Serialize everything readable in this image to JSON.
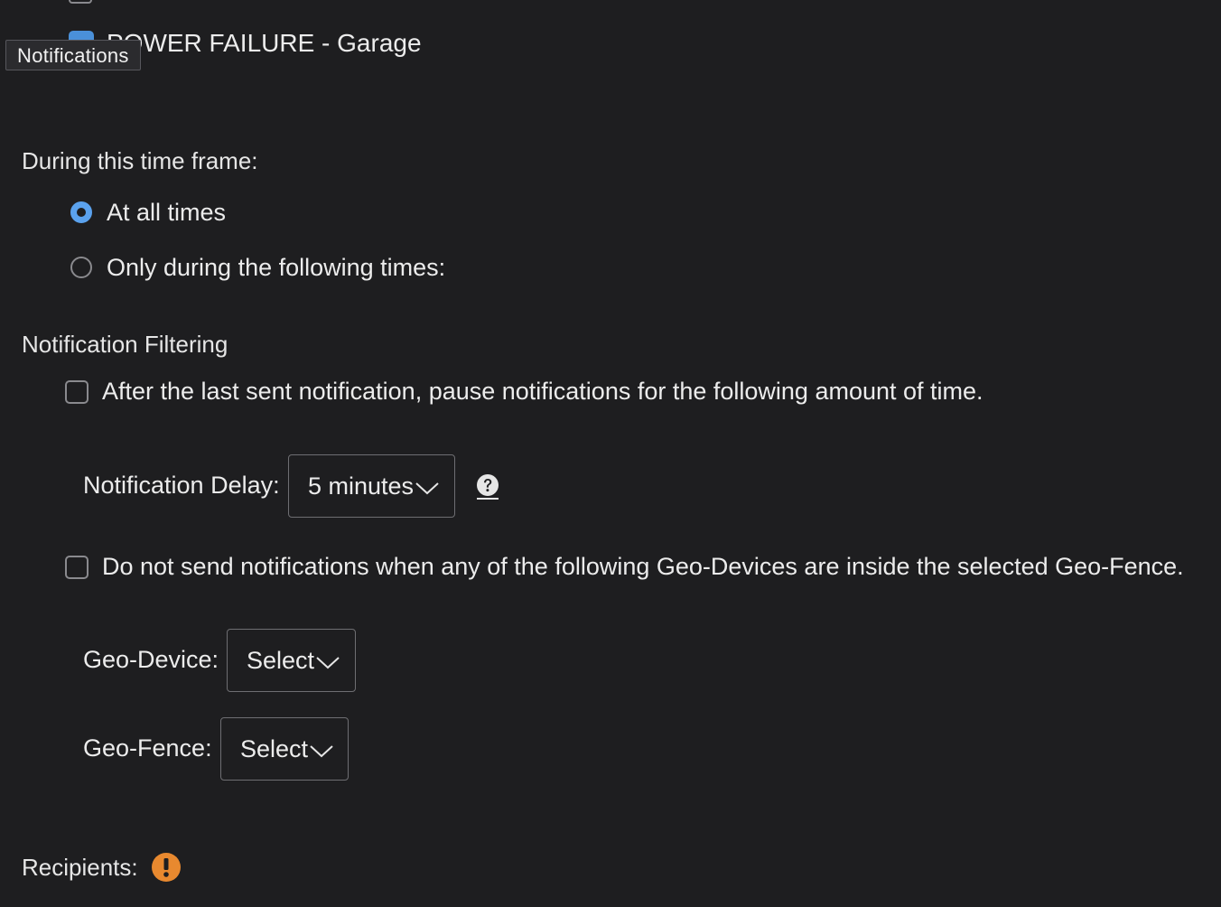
{
  "top": {
    "checked_item_label": "POWER FAILURE - Garage",
    "tooltip": "Notifications"
  },
  "time_frame": {
    "title": "During this time frame:",
    "options": [
      {
        "label": "At all times",
        "selected": true
      },
      {
        "label": "Only during the following times:",
        "selected": false
      }
    ]
  },
  "filtering": {
    "title": "Notification Filtering",
    "pause_checkbox_label": "After the last sent notification, pause notifications for the following amount of time.",
    "delay_label": "Notification Delay:",
    "delay_value": "5 minutes",
    "geo_checkbox_label": "Do not send notifications when any of the following Geo-Devices are inside the selected Geo-Fence.",
    "geo_device_label": "Geo-Device:",
    "geo_device_value": "Select",
    "geo_fence_label": "Geo-Fence:",
    "geo_fence_value": "Select"
  },
  "recipients": {
    "title": "Recipients:"
  },
  "colors": {
    "background": "#1e1e20",
    "accent": "#4a90d9",
    "warning": "#e8892f"
  },
  "icons": [
    "help-icon",
    "alert-icon",
    "chevron-down-icon"
  ]
}
